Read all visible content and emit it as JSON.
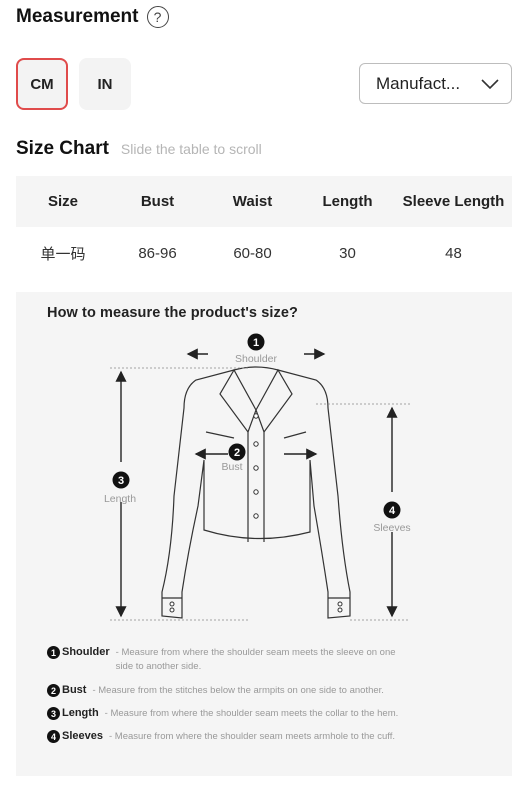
{
  "header": {
    "title": "Measurement",
    "help_icon": "question-circle-icon"
  },
  "units": {
    "cm_label": "CM",
    "in_label": "IN",
    "selected": "CM",
    "accent": "#e04b4b"
  },
  "dropdown": {
    "value": "Manufact...",
    "icon": "chevron-down-icon"
  },
  "size_chart": {
    "title": "Size Chart",
    "hint": "Slide the table to scroll",
    "columns": [
      "Size",
      "Bust",
      "Waist",
      "Length",
      "Sleeve Length"
    ],
    "rows": [
      [
        "单一码",
        "86-96",
        "60-80",
        "30",
        "48"
      ]
    ]
  },
  "guide": {
    "title": "How to measure the product's size?",
    "diagram": {
      "shoulder_num": "1",
      "shoulder_label": "Shoulder",
      "bust_num": "2",
      "bust_label": "Bust",
      "length_num": "3",
      "length_label": "Length",
      "sleeves_num": "4",
      "sleeves_label": "Sleeves"
    },
    "legend": [
      {
        "num": "1",
        "name": "Shoulder",
        "desc": "- Measure from where the shoulder seam meets the sleeve on one side to another side."
      },
      {
        "num": "2",
        "name": "Bust",
        "desc": "- Measure from the stitches below the armpits on one side to another."
      },
      {
        "num": "3",
        "name": "Length",
        "desc": "- Measure from where the shoulder seam meets the collar to the hem."
      },
      {
        "num": "4",
        "name": "Sleeves",
        "desc": "- Measure from where the shoulder seam meets armhole to the cuff."
      }
    ]
  }
}
